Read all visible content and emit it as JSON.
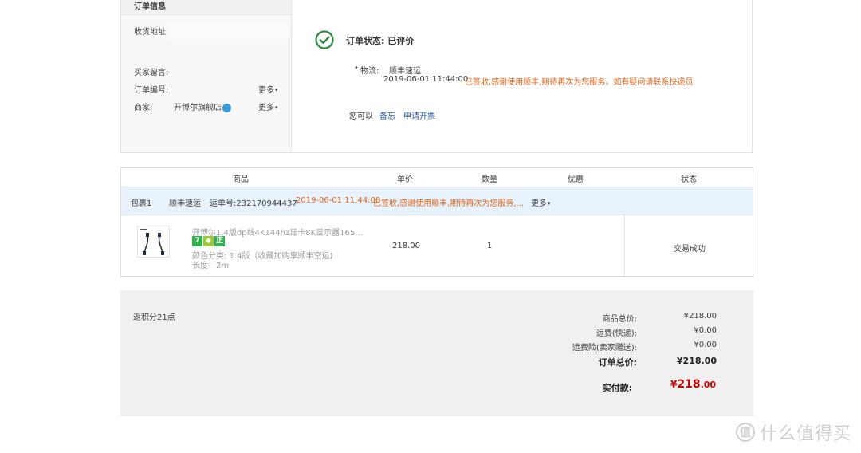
{
  "order_info": {
    "header": "订单信息",
    "address_label": "收货地址",
    "buyer_message_label": "买家留言:",
    "order_number_label": "订单编号:",
    "order_more": "更多",
    "merchant_label": "商家:",
    "merchant_name": "开博尔旗舰店",
    "merchant_more": "更多"
  },
  "status": {
    "title": "订单状态: 已评价",
    "logistics_label": "物流:",
    "logistics_company": "顺丰速运",
    "time": "2019-06-01 11:44:00",
    "message": "已签收,感谢使用顺丰,期待再次为您服务。如有疑问请联系快递员",
    "actions_label": "您可以",
    "action_memo": "备忘",
    "action_invoice": "申请开票"
  },
  "table": {
    "headers": [
      "商品",
      "单价",
      "数量",
      "优惠",
      "状态"
    ],
    "package": {
      "name": "包裹1",
      "company": "顺丰速运",
      "tracking": "运单号:232170944437",
      "time": "2019-06-01 11:44:00",
      "message": "已签收,感谢使用顺丰,期待再次为您服务,...",
      "more": "更多"
    },
    "product": {
      "title": "开博尔1.4版dp线4K144hz显卡8K显示器165...",
      "badges": [
        {
          "text": "7",
          "color": "#2fb44b"
        },
        {
          "text": "",
          "color": "#9bc93d"
        },
        {
          "text": "正",
          "color": "#2fb44b"
        }
      ],
      "sku_label": "颜色分类:",
      "sku_value": "1.4版（收藏加购享顺丰空运)",
      "length": "长度：2m",
      "price": "218.00",
      "quantity": "1",
      "discount": "",
      "status": "交易成功"
    }
  },
  "summary": {
    "points": "返积分21点",
    "rows": [
      {
        "label": "商品总价:",
        "value": "¥218.00"
      },
      {
        "label": "运费(快递):",
        "value": "¥0.00"
      },
      {
        "label": "运费险(卖家赠送):",
        "value": "¥0.00"
      },
      {
        "label": "订单总价:",
        "value": "¥218.00"
      }
    ],
    "paid_label": "实付款:",
    "paid_symbol": "¥",
    "paid_int": "218",
    "paid_dec": ".00"
  },
  "watermark": {
    "icon_text": "值",
    "text": "什么值得买"
  },
  "colors": {
    "accent_orange": "#e0661a",
    "link_blue": "#2a5b9a",
    "success_green": "#2b8a3e",
    "price_red": "#c40000"
  }
}
